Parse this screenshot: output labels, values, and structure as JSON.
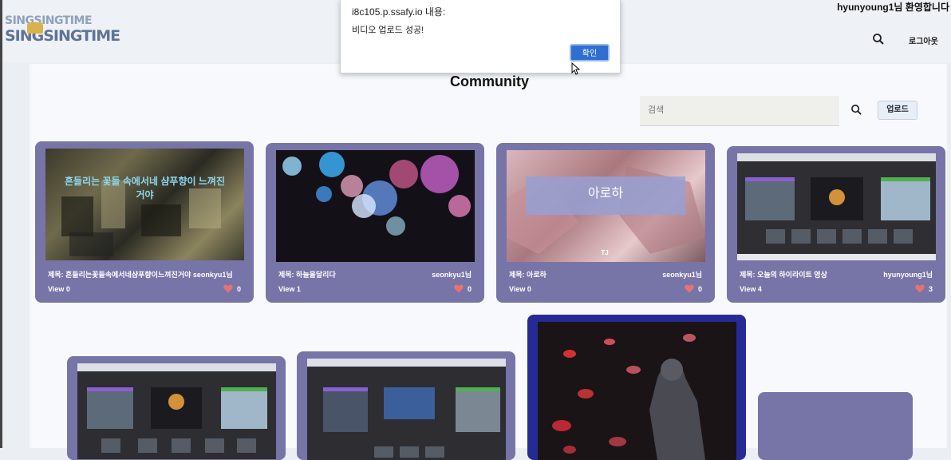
{
  "header": {
    "logo_line1": "SINGSINGTIME",
    "logo_line2": "SINGSINGTIME",
    "welcome": "hyunyoung1님 환영합니다",
    "logout_label": "로그아웃",
    "search_icon": "search-icon"
  },
  "page": {
    "title": "Community",
    "search_placeholder": "검색",
    "upload_label": "업로드"
  },
  "cards": [
    {
      "title": "제목: 흔들리는꽃들속에서네샴푸향이느껴진거야 seonkyu1님",
      "author": "",
      "view": "View 0",
      "likes": "0",
      "thumb_lines": [
        "흔들리는 꽃들 속에서네 샴푸향이 느껴진",
        "거야"
      ]
    },
    {
      "title": "제목: 하늘을달리다",
      "author": "seonkyu1님",
      "view": "View 1",
      "likes": "0"
    },
    {
      "title": "제목: 아로하",
      "author": "seonkyu1님",
      "view": "View 0",
      "likes": "0",
      "thumb_text": "아로하",
      "thumb_brand": "TJ"
    },
    {
      "title": "제목: 오늘의 하이라이트 영상",
      "author": "hyunyoung1님",
      "view": "View 4",
      "likes": "3"
    }
  ],
  "dialog": {
    "title": "i8c105.p.ssafy.io 내용:",
    "message": "비디오 업로드 성공!",
    "ok_label": "확인"
  },
  "colors": {
    "card": "#7774a8",
    "card_selected": "#262a95",
    "accent_button": "#2f6fd0",
    "heart": "#e57373"
  }
}
